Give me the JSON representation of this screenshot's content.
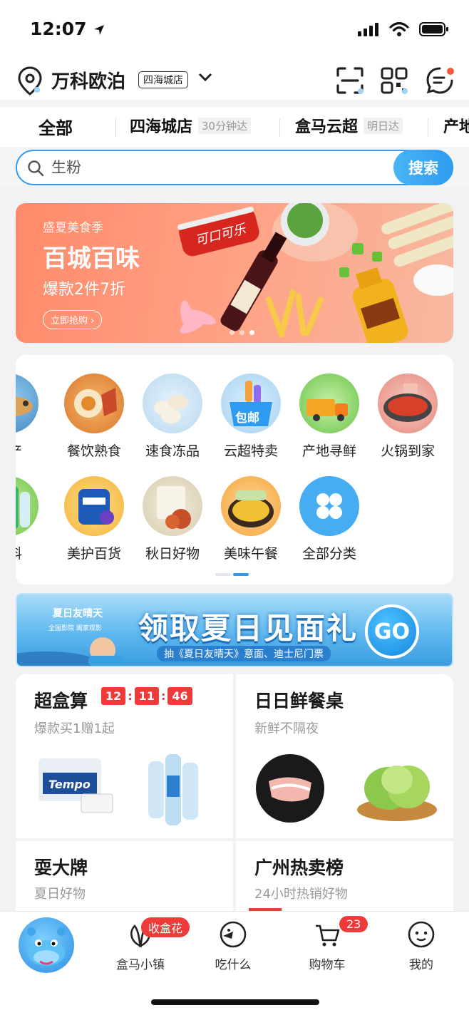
{
  "status_bar": {
    "time": "12:07"
  },
  "header": {
    "location_name": "万科欧泊",
    "store_tag": "四海城店",
    "icons": [
      "location-pin-icon",
      "scan-icon",
      "qrcode-icon",
      "message-icon"
    ]
  },
  "store_tabs": [
    {
      "label": "全部",
      "eta": ""
    },
    {
      "label": "四海城店",
      "eta": "30分钟达"
    },
    {
      "label": "盒马云超",
      "eta": "明日达"
    },
    {
      "label": "产地",
      "eta": ""
    }
  ],
  "search": {
    "value": "生粉",
    "button": "搜索"
  },
  "banner": {
    "kicker": "盛夏美食季",
    "title": "百城百味",
    "subtitle": "爆款2件7折",
    "cta": "立即抢购 ›",
    "bottle_text": "可口可乐"
  },
  "categories": [
    {
      "label": "水产"
    },
    {
      "label": "餐饮熟食"
    },
    {
      "label": "速食冻品"
    },
    {
      "label": "云超特卖",
      "badge": "包邮"
    },
    {
      "label": "产地寻鲜"
    },
    {
      "label": "火锅到家"
    },
    {
      "label": "饮料"
    },
    {
      "label": "美护百货"
    },
    {
      "label": "秋日好物"
    },
    {
      "label": "美味午餐"
    },
    {
      "label": "全部分类"
    }
  ],
  "promo": {
    "left_title": "夏日友晴天",
    "left_sub": "全国影院 阖家观影",
    "title": "领取夏日见面礼",
    "subtitle": "抽《夏日友晴天》意面、迪士尼门票",
    "go": "GO"
  },
  "tiles": [
    {
      "title": "超盒算",
      "subtitle": "爆款买1赠1起",
      "timer": [
        "12",
        "11",
        "46"
      ],
      "product_text": "Tempo"
    },
    {
      "title": "日日鲜餐桌",
      "subtitle": "新鲜不隔夜"
    },
    {
      "title": "耍大牌",
      "subtitle": "夏日好物"
    },
    {
      "title": "广州热卖榜",
      "subtitle": "24小时热销好物"
    }
  ],
  "tabbar": {
    "items": [
      {
        "label": "盒马小镇",
        "badge": "收盒花"
      },
      {
        "label": "吃什么"
      },
      {
        "label": "购物车",
        "badge": "23"
      },
      {
        "label": "我的"
      }
    ]
  },
  "colors": {
    "accent": "#2f9bf0",
    "badge_red": "#ef3a3a",
    "banner_coral": "#ff8a6a"
  }
}
